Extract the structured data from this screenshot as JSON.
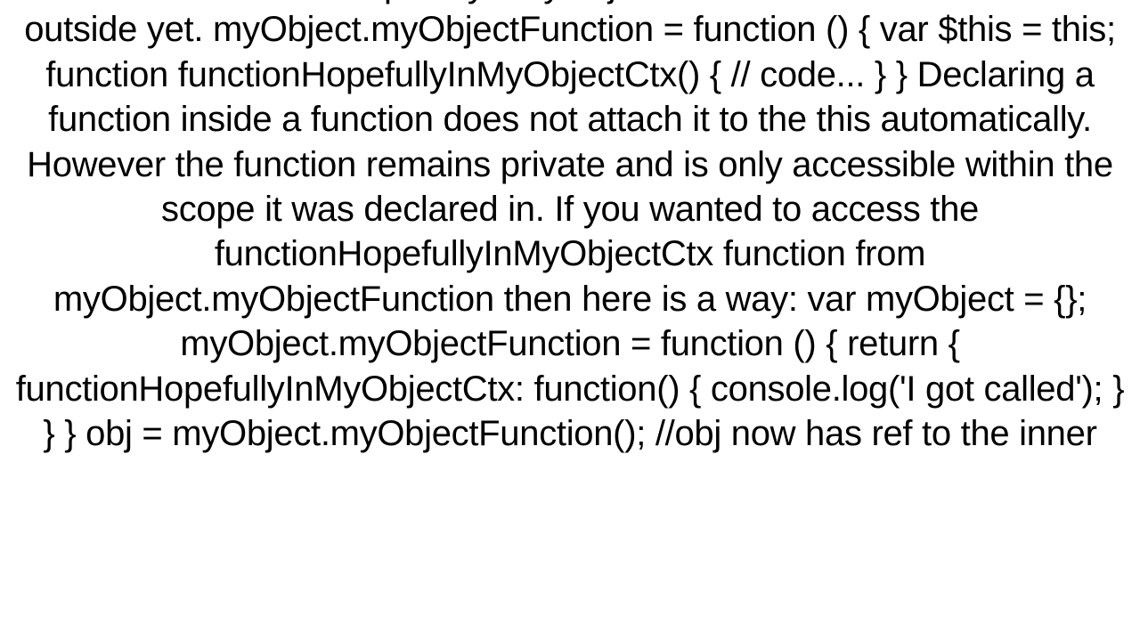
{
  "document": {
    "body_text": "The function functionHopefullyInMyObjectCtx can not be accessed from outside yet. myObject.myObjectFunction = function () {     var $this = this;     function functionHopefullyInMyObjectCtx() {         // code...     } }  Declaring a function inside a function does not attach it to the this automatically. However the function remains private and is only accessible within the scope it was declared in. If you wanted to access the functionHopefullyInMyObjectCtx function from myObject.myObjectFunction then here is a way: var myObject = {};  myObject.myObjectFunction = function () {     return {         functionHopefullyInMyObjectCtx: function() {             console.log('I got called');         }     } }  obj = myObject.myObjectFunction(); //obj now has ref to the inner"
  }
}
